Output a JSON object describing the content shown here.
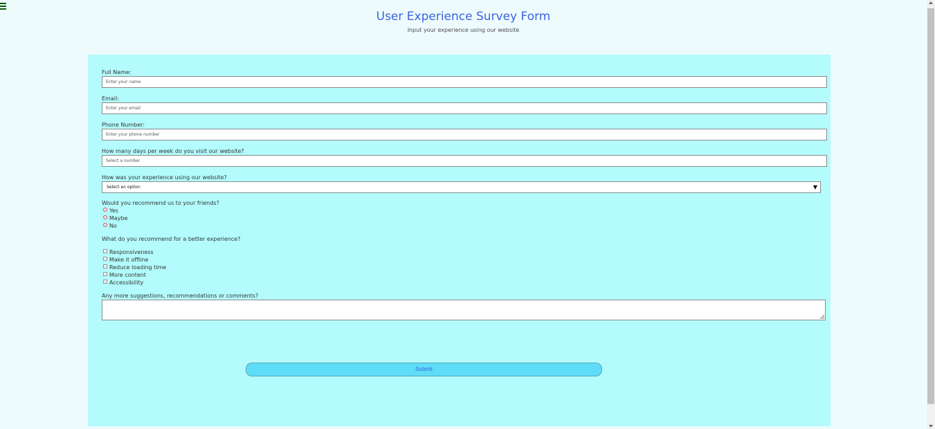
{
  "header": {
    "title": "User Experience Survey Form",
    "subtitle": "Input your experience using our website"
  },
  "form": {
    "full_name": {
      "label": "Full Name:",
      "placeholder": "Enter your name"
    },
    "email": {
      "label": "Email:",
      "placeholder": "Enter your email"
    },
    "phone": {
      "label": "Phone Number:",
      "placeholder": "Enter your phone number"
    },
    "days": {
      "label": "How many days per week do you visit our website?",
      "placeholder": "Select a number"
    },
    "experience": {
      "label": "How was your experience using our website?",
      "selected": "Select an option"
    },
    "recommend": {
      "label": "Would you recommend us to your friends?",
      "options": [
        "Yes",
        "Maybe",
        "No"
      ]
    },
    "improvements": {
      "label": "What do you recommend for a better experience?",
      "options": [
        "Responsiveness",
        "Make it offline",
        "Reduce loading time",
        "More content",
        "Accessibility"
      ]
    },
    "comments": {
      "label": "Any more suggestions, recommendations or comments?"
    },
    "submit_label": "Submit"
  },
  "icons": {
    "menu": "hamburger-menu-icon",
    "select_arrow": "triangle-down-icon"
  },
  "colors": {
    "page_bg": "#eefbfd",
    "panel_bg": "#b3fbfc",
    "title": "#3b63e0",
    "button_bg": "#5fdcf7"
  }
}
